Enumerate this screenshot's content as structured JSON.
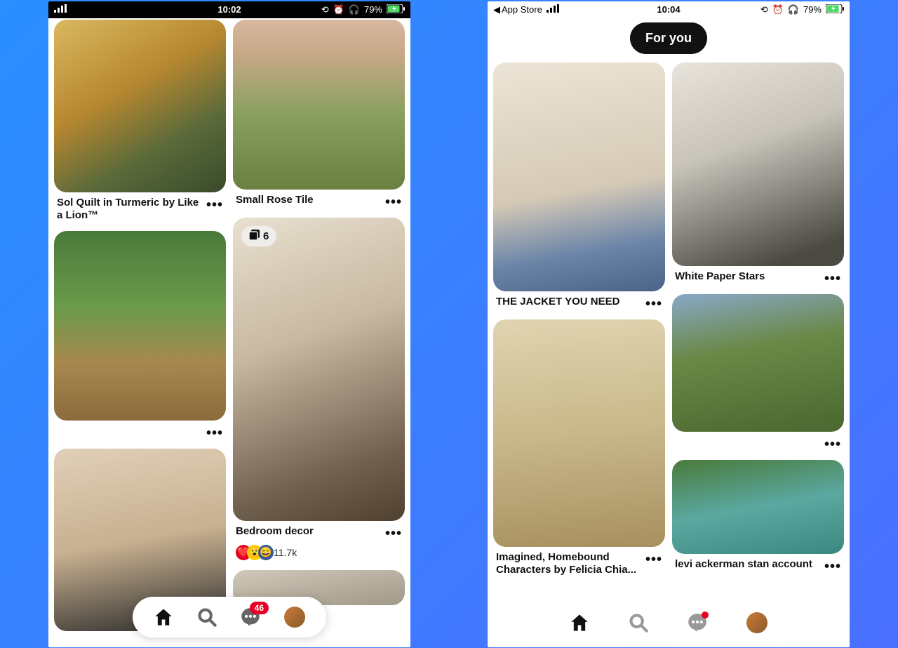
{
  "phone1": {
    "status": {
      "time": "10:02",
      "battery_text": "79%"
    },
    "pins": {
      "quilt": {
        "title": "Sol Quilt in Turmeric by Like a Lion™"
      },
      "rose": {
        "title": "Small Rose Tile"
      },
      "bedroom": {
        "title": "Bedroom decor",
        "reactions_count": "11.7k",
        "collection_count": "6"
      }
    },
    "nav": {
      "notifications_badge": "46"
    }
  },
  "phone2": {
    "status": {
      "back_app": "App Store",
      "time": "10:04",
      "battery_text": "79%"
    },
    "header": {
      "for_you": "For you"
    },
    "pins": {
      "jacket": {
        "title": "THE JACKET YOU NEED"
      },
      "stars": {
        "title": "White Paper Stars"
      },
      "imagined": {
        "title": "Imagined, Homebound Characters by Felicia Chia..."
      },
      "levi": {
        "title": "levi ackerman stan account"
      }
    }
  }
}
